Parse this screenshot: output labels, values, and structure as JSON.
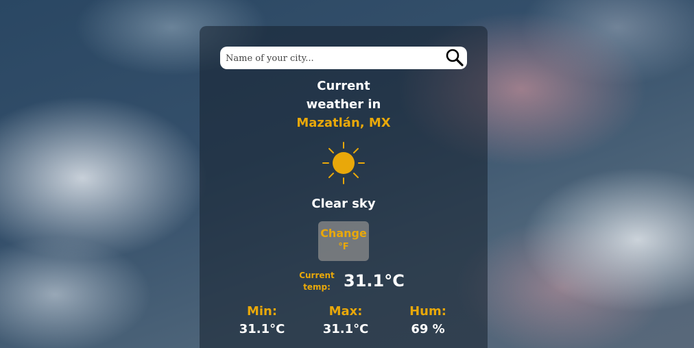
{
  "search": {
    "placeholder": "Name of your city...",
    "value": "",
    "icon": "search-icon"
  },
  "weather": {
    "title_line1": "Current",
    "title_line2": "weather in",
    "city": "Mazatlán, MX",
    "icon": "sun-icon",
    "description": "Clear sky",
    "change_label": "Change",
    "change_unit": "°F",
    "current_label_line1": "Current",
    "current_label_line2": "temp:",
    "current_temp": "31.1°C",
    "min_label": "Min:",
    "min_value": "31.1°C",
    "max_label": "Max:",
    "max_value": "31.1°C",
    "hum_label": "Hum:",
    "hum_value": "69 %"
  },
  "colors": {
    "accent": "#e9a80a",
    "text": "#ffffff"
  }
}
